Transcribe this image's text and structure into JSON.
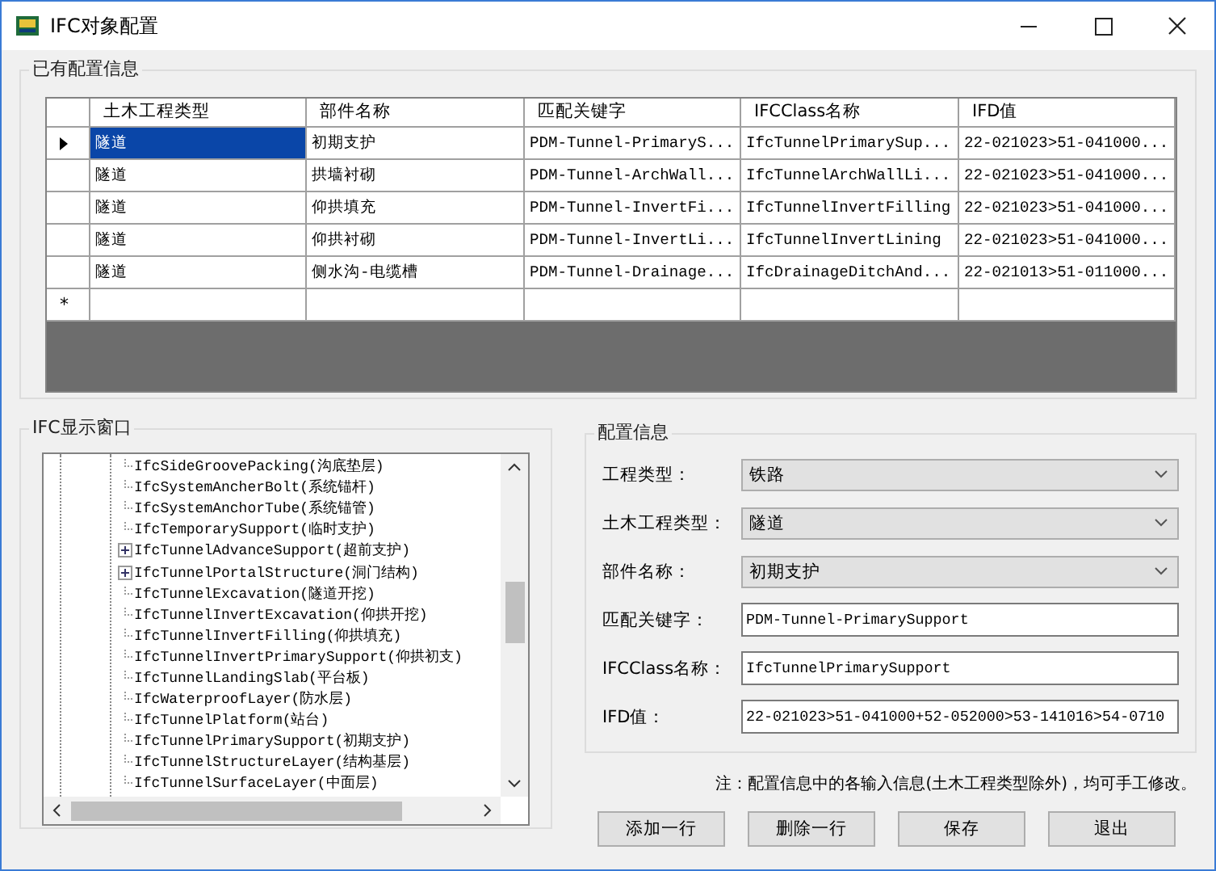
{
  "window": {
    "title": "IFC对象配置"
  },
  "grid_group": {
    "title": "已有配置信息",
    "columns": [
      "土木工程类型",
      "部件名称",
      "匹配关键字",
      "IFCClass名称",
      "IFD值"
    ],
    "rows": [
      {
        "current": true,
        "cells": [
          {
            "text": "隧道",
            "selected": true
          },
          {
            "text": "初期支护",
            "selected": false
          },
          {
            "text": "PDM-Tunnel-PrimaryS...",
            "selected": false
          },
          {
            "text": "IfcTunnelPrimarySup...",
            "selected": false
          },
          {
            "text": "22-021023>51-041000...",
            "selected": false
          }
        ]
      },
      {
        "current": false,
        "cells": [
          {
            "text": "隧道",
            "selected": false
          },
          {
            "text": "拱墙衬砌",
            "selected": false
          },
          {
            "text": "PDM-Tunnel-ArchWall...",
            "selected": false
          },
          {
            "text": "IfcTunnelArchWallLi...",
            "selected": false
          },
          {
            "text": "22-021023>51-041000...",
            "selected": false
          }
        ]
      },
      {
        "current": false,
        "cells": [
          {
            "text": "隧道",
            "selected": false
          },
          {
            "text": "仰拱填充",
            "selected": false
          },
          {
            "text": "PDM-Tunnel-InvertFi...",
            "selected": false
          },
          {
            "text": "IfcTunnelInvertFilling",
            "selected": false
          },
          {
            "text": "22-021023>51-041000...",
            "selected": false
          }
        ]
      },
      {
        "current": false,
        "cells": [
          {
            "text": "隧道",
            "selected": false
          },
          {
            "text": "仰拱衬砌",
            "selected": false
          },
          {
            "text": "PDM-Tunnel-InvertLi...",
            "selected": false
          },
          {
            "text": "IfcTunnelInvertLining",
            "selected": false
          },
          {
            "text": "22-021023>51-041000...",
            "selected": false
          }
        ]
      },
      {
        "current": false,
        "cells": [
          {
            "text": "隧道",
            "selected": false
          },
          {
            "text": "侧水沟-电缆槽",
            "selected": false
          },
          {
            "text": "PDM-Tunnel-Drainage...",
            "selected": false
          },
          {
            "text": "IfcDrainageDitchAnd...",
            "selected": false
          },
          {
            "text": "22-021013>51-011000...",
            "selected": false
          }
        ]
      }
    ],
    "new_row_marker": "*"
  },
  "tree_group": {
    "title": "IFC显示窗口",
    "items": [
      {
        "label": "IfcSideGroovePacking(沟底垫层)",
        "kind": "leaf"
      },
      {
        "label": "IfcSystemAncherBolt(系统锚杆)",
        "kind": "leaf"
      },
      {
        "label": "IfcSystemAnchorTube(系统锚管)",
        "kind": "leaf"
      },
      {
        "label": "IfcTemporarySupport(临时支护)",
        "kind": "leaf"
      },
      {
        "label": "IfcTunnelAdvanceSupport(超前支护)",
        "kind": "collapsed"
      },
      {
        "label": "IfcTunnelPortalStructure(洞门结构)",
        "kind": "collapsed"
      },
      {
        "label": "IfcTunnelExcavation(隧道开挖)",
        "kind": "leaf"
      },
      {
        "label": "IfcTunnelInvertExcavation(仰拱开挖)",
        "kind": "leaf"
      },
      {
        "label": "IfcTunnelInvertFilling(仰拱填充)",
        "kind": "leaf"
      },
      {
        "label": "IfcTunnelInvertPrimarySupport(仰拱初支)",
        "kind": "leaf"
      },
      {
        "label": "IfcTunnelLandingSlab(平台板)",
        "kind": "leaf"
      },
      {
        "label": "IfcWaterproofLayer(防水层)",
        "kind": "leaf"
      },
      {
        "label": "IfcTunnelPlatform(站台)",
        "kind": "leaf"
      },
      {
        "label": "IfcTunnelPrimarySupport(初期支护)",
        "kind": "leaf"
      },
      {
        "label": "IfcTunnelStructureLayer(结构基层)",
        "kind": "leaf"
      },
      {
        "label": "IfcTunnelSurfaceLayer(中面层)",
        "kind": "leaf"
      }
    ]
  },
  "config_group": {
    "title": "配置信息",
    "fields": [
      {
        "label": "工程类型：",
        "kind": "dropdown",
        "value": "铁路"
      },
      {
        "label": "土木工程类型：",
        "kind": "dropdown",
        "value": "隧道"
      },
      {
        "label": "部件名称：",
        "kind": "dropdown",
        "value": "初期支护"
      },
      {
        "label": "匹配关键字：",
        "kind": "text",
        "value": "PDM-Tunnel-PrimarySupport"
      },
      {
        "label": "IFCClass名称：",
        "kind": "text",
        "value": "IfcTunnelPrimarySupport"
      },
      {
        "label": "IFD值：",
        "kind": "text",
        "value": "22-021023>51-041000+52-052000>53-141016>54-0710"
      }
    ]
  },
  "note": "注：配置信息中的各输入信息(土木工程类型除外)，均可手工修改。",
  "buttons": [
    "添加一行",
    "删除一行",
    "保存",
    "退出"
  ]
}
